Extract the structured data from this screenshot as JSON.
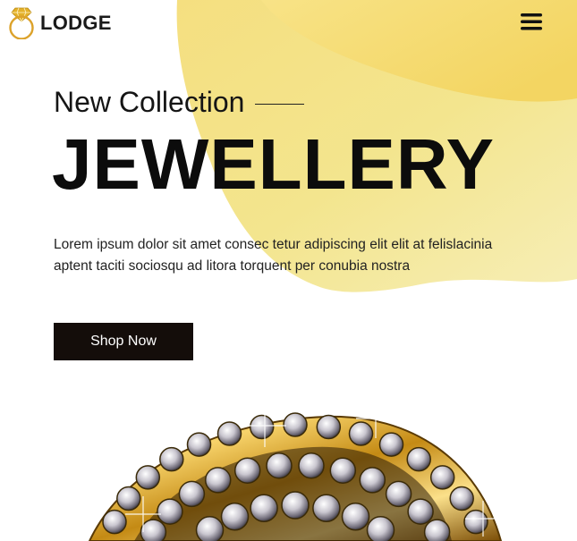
{
  "brand": {
    "name": "LODGE",
    "logo_icon": "diamond-ring-icon"
  },
  "header": {
    "menu_icon": "hamburger-menu-icon"
  },
  "hero": {
    "eyebrow": "New Collection",
    "headline": "JEWELLERY",
    "description": "Lorem ipsum dolor sit amet consec tetur adipiscing elit elit at felislacinia aptent taciti sociosqu ad litora torquent per conubia nostra",
    "cta_label": "Shop Now",
    "image": "gold-diamond-ring-image"
  },
  "colors": {
    "accent_yellow": "#f6dc72",
    "cta_background": "#140d0a",
    "text_dark": "#111111",
    "gold": "#d9a520"
  }
}
